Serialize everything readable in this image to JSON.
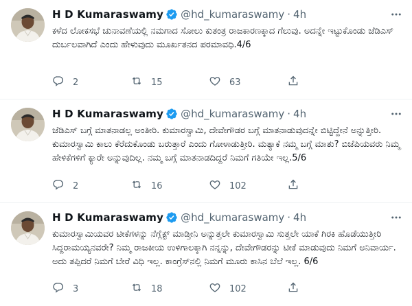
{
  "tweets": [
    {
      "name": "H D Kumaraswamy",
      "handle": "@hd_kumaraswamy",
      "separator": "·",
      "time": "4h",
      "text": "ಕಳೆದ ಲೋಕಸಭೆ ಚುನಾವಣೆಯಲ್ಲಿ ನಮಗಾದ ಸೋಲು ಕುತಂತ್ರ ರಾಜಕಾರಣಕ್ಕಾದ ಗೆಲುವು. ಅದನ್ನೇ ಇಟ್ಟುಕೊಂಡು ಜೆಡಿಎಸ್ ದುರ್ಬಲವಾಗಿದೆ ಎಂದು ಹೇಳುವುದು ಮೂರ್ಖತನದ ಪರಮಾವಧಿ.4/6",
      "replies": "2",
      "retweets": "15",
      "likes": "63"
    },
    {
      "name": "H D Kumaraswamy",
      "handle": "@hd_kumaraswamy",
      "separator": "·",
      "time": "4h",
      "text": "ಜೆಡಿಎಸ್ ಬಗ್ಗೆ ಮಾತನಾಡಲ್ಲ ಅಂತೀರಿ. ಕುಮಾರಸ್ವಾಮಿ, ದೇವೇಗೌಡರ ಬಗ್ಗೆ ಮಾತನಾಡುವುದನ್ನೇ ಬಿಟ್ಟಿದ್ದೇನೆ ಅನ್ನುತ್ತೀರಿ. ಕುಮಾರಸ್ವಾಮಿ ಕಾಲು ಕೆರೆದುಕೊಂಡು ಬರುತ್ತಾರೆ ಎಂದು ಗೋಳಾಡುತ್ತೀರಿ. ಮತ್ಯಾಕೆ ನಮ್ಮ ಬಗ್ಗೆ ಮಾತು? ಬಿಜೆಪಿಯವರು ನಿಮ್ಮ ಹೇಳಿಕೆಗಳಿಗೆ ಕ್ಯಾರೇ ಅನ್ನುವುದಿಲ್ಲ. ನಮ್ಮ ಬಗ್ಗೆ ಮಾತನಾಡದಿದ್ದರೆ ನಿಮಗೆ ಗತಿಯೇ ಇಲ್ಲ.5/6",
      "replies": "2",
      "retweets": "16",
      "likes": "102"
    },
    {
      "name": "H D Kumaraswamy",
      "handle": "@hd_kumaraswamy",
      "separator": "·",
      "time": "4h",
      "text": "ಕುಮಾರಸ್ವಾಮಿಯವರ ಟೀಕೆಗಳನ್ನು ನೆಗ್ಲೆಕ್ಟ್ ಮಾಡ್ತೀನಿ ಅನ್ನುತ್ತಲೇ ಕುಮಾರಸ್ವಾಮಿ ಸುತ್ತಲೇ ಯಾಕೆ ಗಿರಕಿ ಹೊಡೆಯುತ್ತೀರಿ ಸಿದ್ದರಾಮಯ್ಯನವರೇ? ನಿಮ್ಮ ರಾಜಕೀಯ ಉಳಿಗಾಲಕ್ಕಾಗಿ ನನ್ನನ್ನು, ದೇವೇಗೌಡರನ್ನು ಟೀಕೆ ಮಾಡುವುದು ನಿಮಗೆ ಅನಿವಾರ್ಯ. ಅದು ತಪ್ಪಿದರೆ ನಿಮಗೆ ಬೇರೆ ವಿಧಿ ಇಲ್ಲ. ಕಾಂಗ್ರೆಸ್‌ನಲ್ಲಿ ನಿಮಗೆ ಮೂರು ಕಾಸಿನ ಬೆಲೆ ಇಲ್ಲ. 6/6",
      "replies": "3",
      "retweets": "18",
      "likes": "102"
    }
  ],
  "icons": {
    "more": "more-icon",
    "verified": "verified-badge-icon",
    "reply": "reply-icon",
    "retweet": "retweet-icon",
    "like": "like-icon",
    "share": "share-icon"
  },
  "colors": {
    "verified": "#1d9bf0",
    "secondary_text": "#536471",
    "divider": "#eff3f4"
  }
}
